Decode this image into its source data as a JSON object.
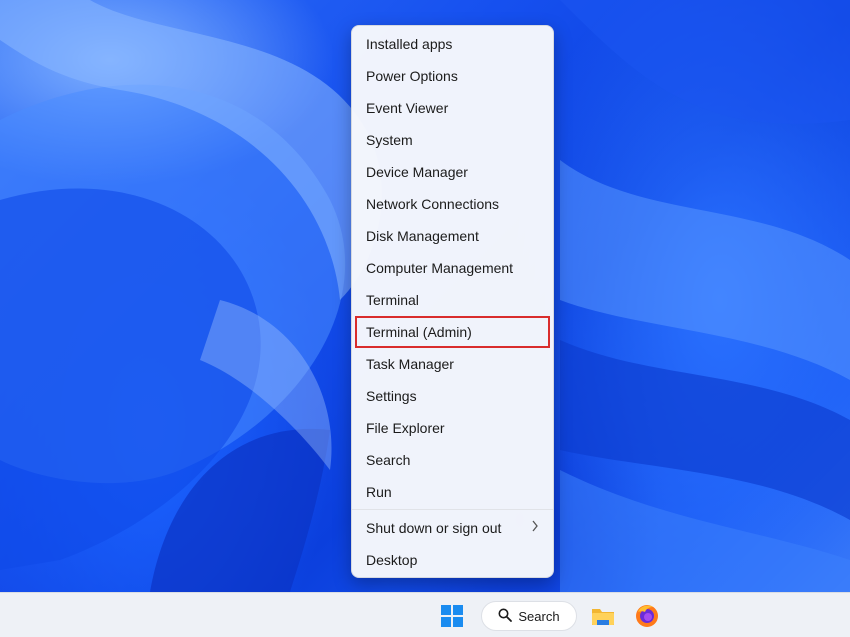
{
  "desktop": {
    "wallpaper": "bloom-wallpaper"
  },
  "menu": {
    "items": [
      {
        "label": "Installed apps"
      },
      {
        "label": "Power Options"
      },
      {
        "label": "Event Viewer"
      },
      {
        "label": "System"
      },
      {
        "label": "Device Manager"
      },
      {
        "label": "Network Connections"
      },
      {
        "label": "Disk Management"
      },
      {
        "label": "Computer Management"
      },
      {
        "label": "Terminal"
      },
      {
        "label": "Terminal (Admin)",
        "highlighted": true,
        "highlight_color": "#d92c2c"
      },
      {
        "label": "Task Manager"
      },
      {
        "label": "Settings"
      },
      {
        "label": "File Explorer"
      },
      {
        "label": "Search"
      },
      {
        "label": "Run"
      },
      {
        "label": "Shut down or sign out",
        "submenu_icon": "chevron-right-icon"
      },
      {
        "label": "Desktop"
      }
    ]
  },
  "taskbar": {
    "start_icon": "windows-logo-icon",
    "search_label": "Search",
    "search_icon": "search-icon",
    "pinned": [
      "file-explorer-icon",
      "firefox-icon"
    ],
    "accent": "#1a8cf0"
  }
}
